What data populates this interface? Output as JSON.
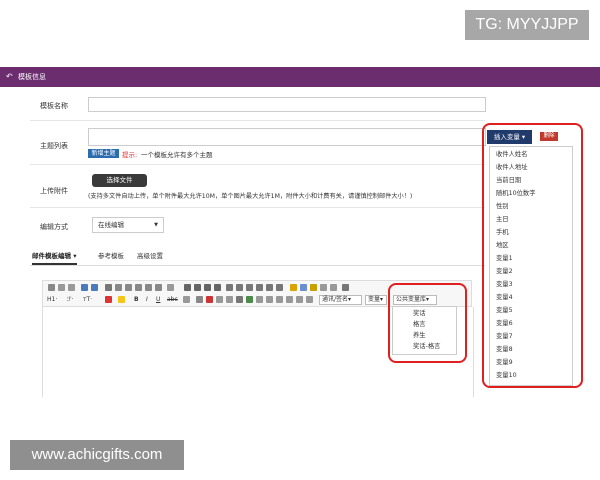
{
  "watermarks": {
    "top": "TG: MYYJJPP",
    "bottom": "www.achicgifts.com"
  },
  "header": {
    "title": "模板信息"
  },
  "form": {
    "template_name_label": "模板名称",
    "subject_list_label": "主题列表",
    "new_subject_badge": "新增主题",
    "subject_hint_prefix": "提示:",
    "subject_hint_text": "一个模板允许有多个主题",
    "upload_label": "上传附件",
    "choose_file_button": "选择文件",
    "upload_hint": "(支持多文件自动上传，单个附件最大允许10M，单个图片最大允许1M，附件大小和计费有关，请谨慎控制邮件大小！)",
    "edit_mode_label": "编辑方式",
    "edit_mode_value": "在线编辑"
  },
  "variables_panel": {
    "insert_button": "插入变量",
    "delete_button": "删除",
    "items": [
      "收件人姓名",
      "收件人地址",
      "当前日期",
      "随机10位数字",
      "性别",
      "主日",
      "手机",
      "地区",
      "变量1",
      "变量2",
      "变量3",
      "变量4",
      "变量5",
      "变量6",
      "变量7",
      "变量8",
      "变量9",
      "变量10"
    ]
  },
  "tabs": [
    "邮件模板编辑",
    "参考模板",
    "高级设置"
  ],
  "toolbar": {
    "heading": "H1·",
    "font": "ℱ·",
    "size": "ᴛT·",
    "general_select": "通讯/签名",
    "variable_select": "变量",
    "public_library_select": "公共变量库"
  },
  "public_library": {
    "items": [
      "奖话",
      "格言",
      "养生",
      "奖话-格言"
    ]
  },
  "colors": {
    "header": "#6b2d6e",
    "highlight": "#e02020",
    "insert": "#1f3a6b"
  }
}
